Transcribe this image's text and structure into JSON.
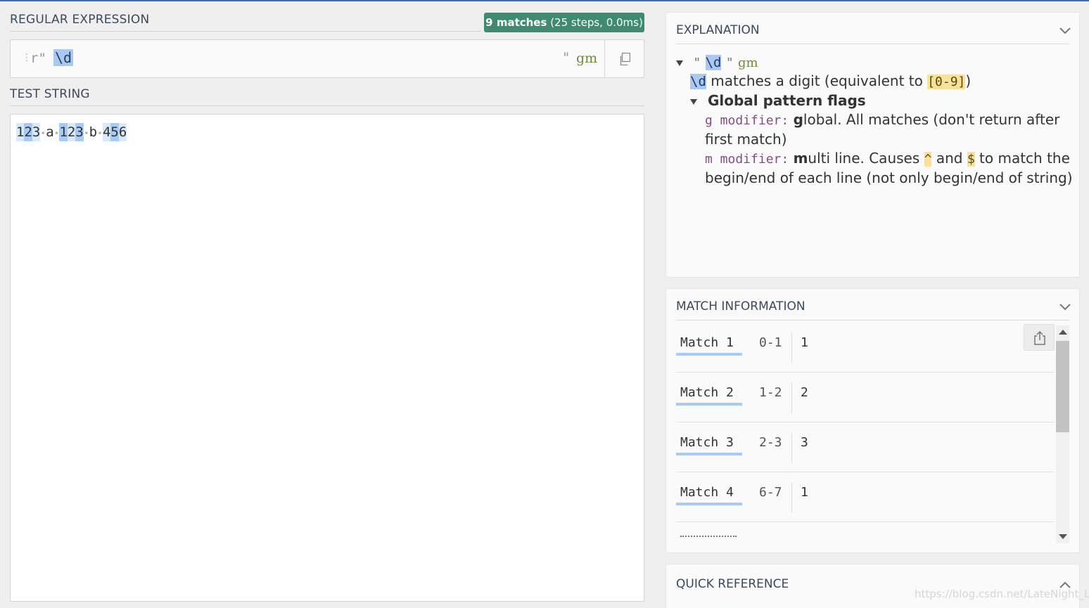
{
  "regex_section": {
    "title": "REGULAR EXPRESSION",
    "match_badge_bold": "9 matches",
    "match_badge_detail": " (25 steps, 0.0ms)",
    "prefix": "r\"",
    "pattern": "\\d",
    "flags_quote": "\"",
    "flags": "gm"
  },
  "test_section": {
    "title": "TEST STRING",
    "chars": [
      "1",
      "2",
      "3",
      "a",
      "1",
      "2",
      "3",
      "b",
      "4",
      "5",
      "6"
    ]
  },
  "explanation": {
    "title": "EXPLANATION",
    "quote_open": "\"",
    "token": "\\d",
    "quote_close": "\"",
    "flags": "gm",
    "token_desc_before": "matches a digit (equivalent to",
    "token_desc_class": "[0-9]",
    "token_desc_after": ")",
    "flags_heading": "Global pattern flags",
    "g_mod": "g modifier:",
    "g_bold": "g",
    "g_rest": "lobal. All matches (don't return after",
    "g_rest2": "first match)",
    "m_mod": "m modifier:",
    "m_bold": "m",
    "m_rest": "ulti line. Causes",
    "caret": "^",
    "and": "and",
    "dollar": "$",
    "m_rest2": "to match the",
    "m_rest3": "begin/end of each line (not only begin/end of string)"
  },
  "match_info": {
    "title": "MATCH INFORMATION",
    "matches": [
      {
        "label": "Match 1",
        "range": "0-1",
        "value": "1"
      },
      {
        "label": "Match 2",
        "range": "1-2",
        "value": "2"
      },
      {
        "label": "Match 3",
        "range": "2-3",
        "value": "3"
      },
      {
        "label": "Match 4",
        "range": "6-7",
        "value": "1"
      }
    ]
  },
  "quick_reference": {
    "title": "QUICK REFERENCE"
  },
  "watermark": "https://blog.csdn.net/LateNight_LL",
  "colors": {
    "accent": "#3a6fb4",
    "badge": "#3f8a70",
    "match_primary": "#a7cbf3",
    "match_secondary": "#d8e9fa"
  },
  "icons": {
    "copy": "copy-icon",
    "export": "export-icon",
    "chevron": "chevron-icon",
    "collapse": "triangle-down-icon"
  }
}
